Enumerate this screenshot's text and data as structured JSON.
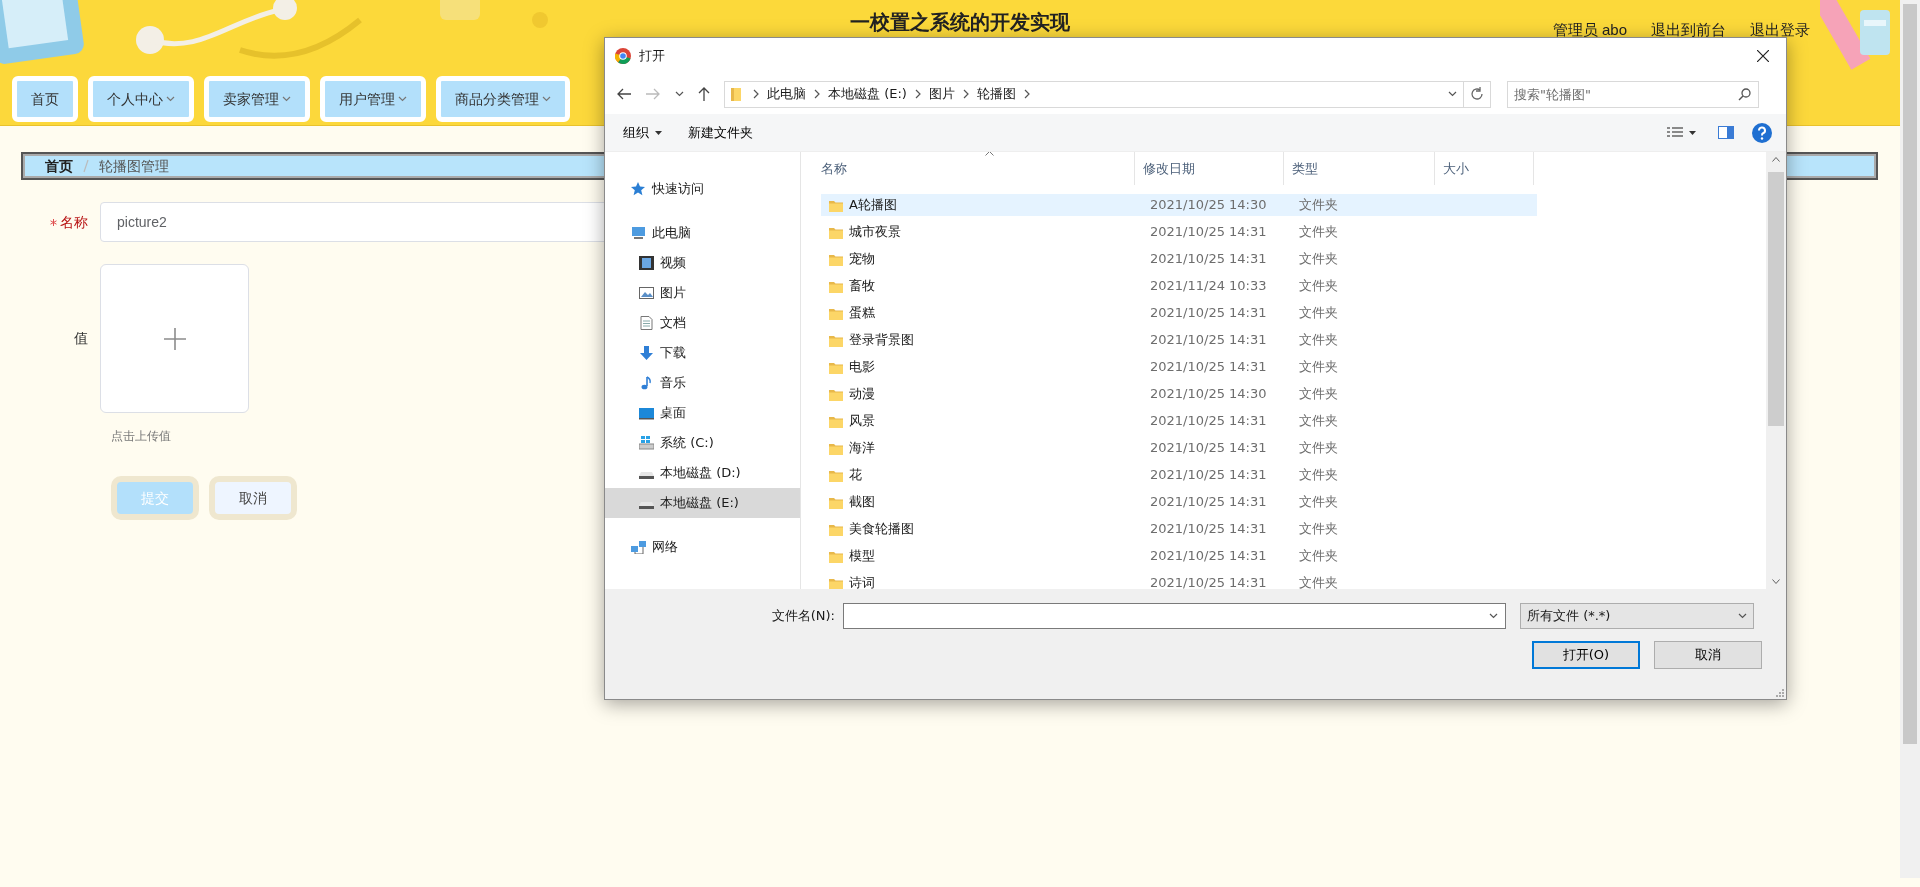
{
  "header": {
    "title": "一校置之系统的开发实现",
    "user": "管理员 abo",
    "links": [
      "退出到前台",
      "退出登录"
    ]
  },
  "nav": [
    {
      "label": "首页",
      "dropdown": false
    },
    {
      "label": "个人中心",
      "dropdown": true
    },
    {
      "label": "卖家管理",
      "dropdown": true
    },
    {
      "label": "用户管理",
      "dropdown": true
    },
    {
      "label": "商品分类管理",
      "dropdown": true
    }
  ],
  "breadcrumb": [
    "首页",
    "轮播图管理"
  ],
  "form": {
    "fields": [
      {
        "kind": "text",
        "label": "名称",
        "required": true,
        "value": "picture2"
      },
      {
        "kind": "upload",
        "label": "值",
        "required": false,
        "hint": "点击上传值"
      }
    ],
    "buttons": [
      {
        "label": "提交",
        "kind": "primary"
      },
      {
        "label": "取消",
        "kind": "default"
      }
    ]
  },
  "dialog": {
    "title": "打开",
    "path": [
      "此电脑",
      "本地磁盘 (E:)",
      "图片",
      "轮播图"
    ],
    "search": {
      "placeholder": "搜索\"轮播图\""
    },
    "toolbar": [
      {
        "label": "组织",
        "dropdown": true
      },
      {
        "label": "新建文件夹",
        "dropdown": false
      }
    ],
    "sidebar": [
      {
        "label": "快速访问",
        "kind": "quick-access",
        "selected": false
      },
      {
        "label": "此电脑",
        "kind": "computer",
        "selected": false,
        "children": [
          {
            "label": "视频",
            "kind": "videos",
            "selected": false
          },
          {
            "label": "图片",
            "kind": "pictures",
            "selected": false
          },
          {
            "label": "文档",
            "kind": "documents",
            "selected": false
          },
          {
            "label": "下载",
            "kind": "downloads",
            "selected": false
          },
          {
            "label": "音乐",
            "kind": "music",
            "selected": false
          },
          {
            "label": "桌面",
            "kind": "desktop",
            "selected": false
          },
          {
            "label": "系统 (C:)",
            "kind": "system-drive",
            "selected": false
          },
          {
            "label": "本地磁盘 (D:)",
            "kind": "drive",
            "selected": false
          },
          {
            "label": "本地磁盘 (E:)",
            "kind": "drive",
            "selected": true
          }
        ]
      },
      {
        "label": "网络",
        "kind": "network",
        "selected": false
      }
    ],
    "columns": [
      "名称",
      "修改日期",
      "类型",
      "大小"
    ],
    "rows": [
      {
        "name": "A轮播图",
        "modified": "2021/10/25 14:30",
        "type": "文件夹",
        "selected": true
      },
      {
        "name": "城市夜景",
        "modified": "2021/10/25 14:31",
        "type": "文件夹",
        "selected": false
      },
      {
        "name": "宠物",
        "modified": "2021/10/25 14:31",
        "type": "文件夹",
        "selected": false
      },
      {
        "name": "畜牧",
        "modified": "2021/11/24 10:33",
        "type": "文件夹",
        "selected": false
      },
      {
        "name": "蛋糕",
        "modified": "2021/10/25 14:31",
        "type": "文件夹",
        "selected": false
      },
      {
        "name": "登录背景图",
        "modified": "2021/10/25 14:31",
        "type": "文件夹",
        "selected": false
      },
      {
        "name": "电影",
        "modified": "2021/10/25 14:31",
        "type": "文件夹",
        "selected": false
      },
      {
        "name": "动漫",
        "modified": "2021/10/25 14:30",
        "type": "文件夹",
        "selected": false
      },
      {
        "name": "风景",
        "modified": "2021/10/25 14:31",
        "type": "文件夹",
        "selected": false
      },
      {
        "name": "海洋",
        "modified": "2021/10/25 14:31",
        "type": "文件夹",
        "selected": false
      },
      {
        "name": "花",
        "modified": "2021/10/25 14:31",
        "type": "文件夹",
        "selected": false
      },
      {
        "name": "截图",
        "modified": "2021/10/25 14:31",
        "type": "文件夹",
        "selected": false
      },
      {
        "name": "美食轮播图",
        "modified": "2021/10/25 14:31",
        "type": "文件夹",
        "selected": false
      },
      {
        "name": "模型",
        "modified": "2021/10/25 14:31",
        "type": "文件夹",
        "selected": false
      },
      {
        "name": "诗词",
        "modified": "2021/10/25 14:31",
        "type": "文件夹",
        "selected": false
      }
    ],
    "filename_label": "文件名(N):",
    "filter": "所有文件 (*.*)",
    "buttons": [
      {
        "label": "打开(O)",
        "kind": "default"
      },
      {
        "label": "取消",
        "kind": "normal"
      }
    ]
  }
}
